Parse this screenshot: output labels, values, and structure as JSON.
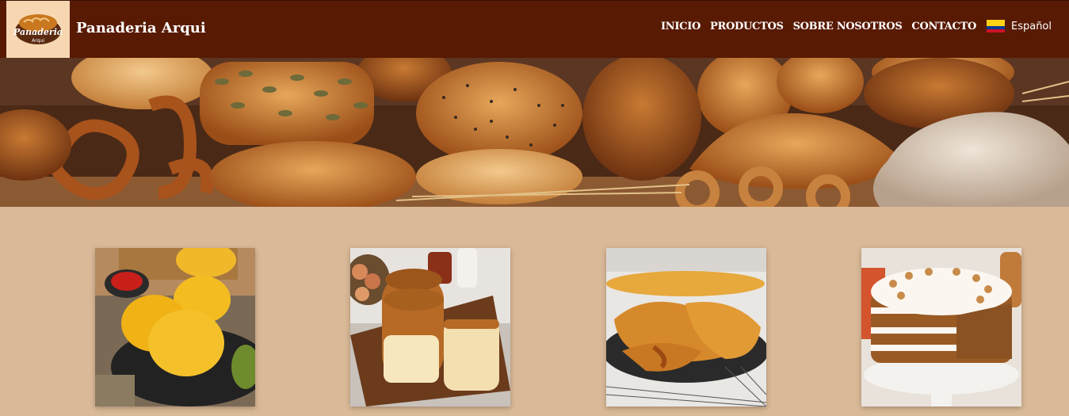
{
  "brand": {
    "name": "Panaderia Arqui",
    "logo_text": "Panaderia",
    "logo_subtext": "Arqui"
  },
  "nav": {
    "links": [
      "INICIO",
      "PRODUCTOS",
      "SOBRE NOSOTROS",
      "CONTACTO"
    ],
    "language": "Español",
    "flag": "colombia-flag-icon"
  },
  "colors": {
    "navbar": "#581a03",
    "background": "#d9b997",
    "logo_bg": "#f6d7b1"
  },
  "hero": {
    "image": "assorted-breads-banner"
  },
  "products": [
    {
      "image": "arepas-de-huevo-photo"
    },
    {
      "image": "pan-brioche-photo"
    },
    {
      "image": "hojaldre-relleno-photo"
    },
    {
      "image": "torta-de-zanahoria-photo"
    }
  ]
}
